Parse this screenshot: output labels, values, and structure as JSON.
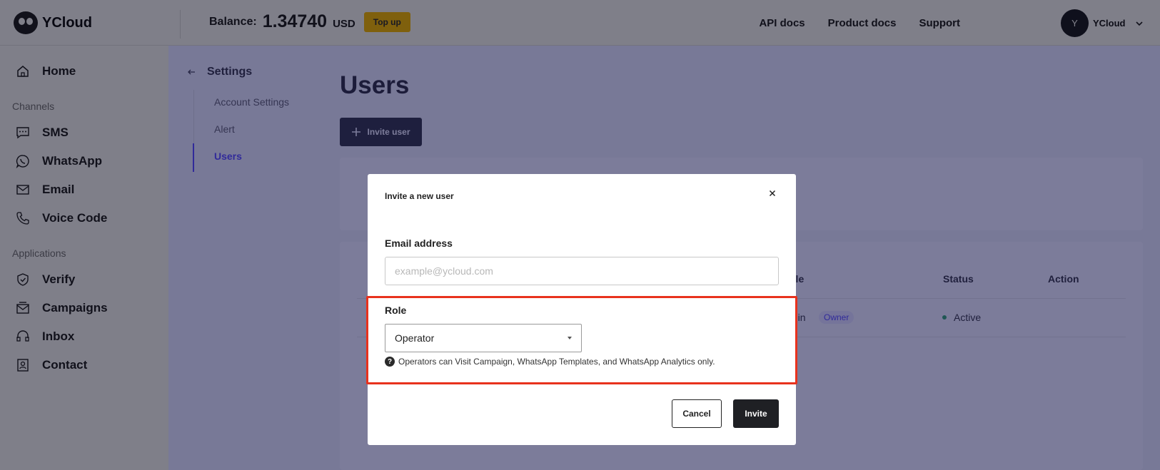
{
  "header": {
    "brand": "YCloud",
    "balance_label": "Balance:",
    "balance_value": "1.34740",
    "balance_unit": "USD",
    "topup_label": "Top up",
    "links": [
      "API docs",
      "Product docs",
      "Support"
    ],
    "user_initial": "Y",
    "user_name": "YCloud",
    "topup_color": "#ffc107"
  },
  "sidebar": {
    "home": "Home",
    "channels_label": "Channels",
    "channels": [
      {
        "label": "SMS",
        "icon": "sms-icon"
      },
      {
        "label": "WhatsApp",
        "icon": "whatsapp-icon"
      },
      {
        "label": "Email",
        "icon": "email-icon"
      },
      {
        "label": "Voice Code",
        "icon": "phone-icon"
      }
    ],
    "applications_label": "Applications",
    "applications": [
      {
        "label": "Verify",
        "icon": "shield-icon"
      },
      {
        "label": "Campaigns",
        "icon": "campaign-icon"
      },
      {
        "label": "Inbox",
        "icon": "headset-icon"
      },
      {
        "label": "Contact",
        "icon": "contact-icon"
      }
    ]
  },
  "settings": {
    "title": "Settings",
    "items": [
      "Account Settings",
      "Alert",
      "Users"
    ],
    "active_index": 2,
    "accent": "#4a3aff"
  },
  "main": {
    "title": "Users",
    "invite_button": "Invite user",
    "table": {
      "headers": [
        "ole",
        "Status",
        "Action"
      ],
      "row": {
        "role": "min",
        "badge": "Owner",
        "status": "Active"
      }
    }
  },
  "modal": {
    "title": "Invite a new user",
    "email_label": "Email address",
    "email_placeholder": "example@ycloud.com",
    "role_label": "Role",
    "role_value": "Operator",
    "role_help": "Operators can Visit Campaign, WhatsApp Templates, and WhatsApp Analytics only.",
    "cancel": "Cancel",
    "invite": "Invite",
    "highlight_color": "#e8321d"
  }
}
